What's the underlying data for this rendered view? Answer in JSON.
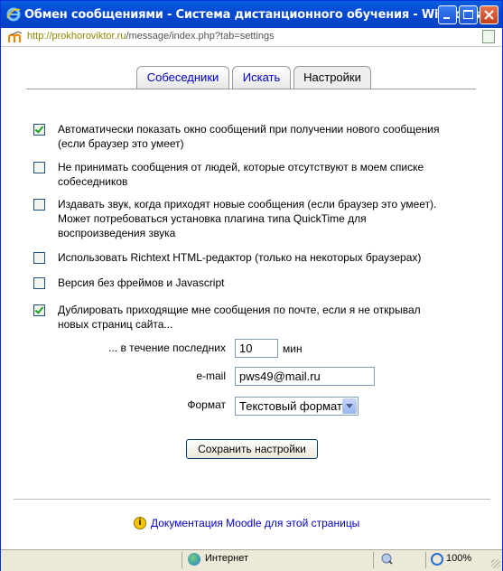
{
  "window": {
    "title": "Обмен сообщениями - Система дистанционного обучения - Windows..."
  },
  "address": {
    "host": "http://prokhoroviktоr.ru",
    "path": "/message/index.php?tab=settings"
  },
  "tabs": [
    {
      "label": "Собеседники",
      "active": false
    },
    {
      "label": "Искать",
      "active": false
    },
    {
      "label": "Настройки",
      "active": true
    }
  ],
  "options": [
    {
      "checked": true,
      "lines": [
        "Автоматически показать окно сообщений при получении нового сообщения",
        "(если браузер это умеет)"
      ]
    },
    {
      "checked": false,
      "lines": [
        "Не принимать сообщения от людей, которые отсутствуют в моем списке",
        "собеседников"
      ]
    },
    {
      "checked": false,
      "lines": [
        "Издавать звук, когда приходят новые сообщения (если браузер это умеет).",
        "Может потребоваться установка плагина типа QuickTime для",
        "воспроизведения звука"
      ]
    },
    {
      "checked": false,
      "lines": [
        "Использовать Richtext HTML-редактор (только на некоторых браузерах)"
      ]
    },
    {
      "checked": false,
      "lines": [
        "Версия без фреймов и Javascript"
      ]
    },
    {
      "checked": true,
      "lines": [
        "Дублировать приходящие мне сообщения по почте, если я не открывал",
        "новых страниц сайта..."
      ]
    }
  ],
  "email_settings": {
    "period_label": "... в течение последних",
    "period_value": "10",
    "period_unit": "мин",
    "email_label": "e-mail",
    "email_value": "pws49@mail.ru",
    "format_label": "Формат",
    "format_value": "Текстовый формат"
  },
  "save_button": "Сохранить настройки",
  "doc_link": "Документация Moodle для этой страницы",
  "statusbar": {
    "zone": "Интернет",
    "zoom": "100%"
  }
}
